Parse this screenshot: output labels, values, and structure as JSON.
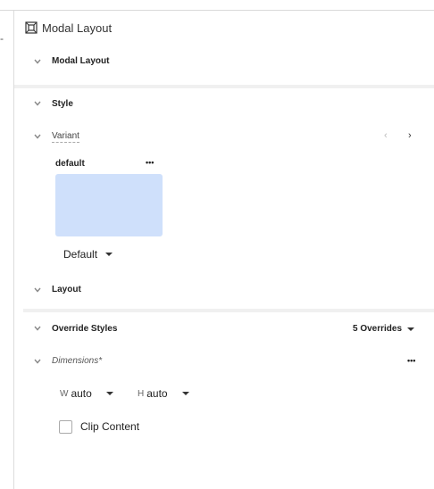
{
  "panel": {
    "title": "Modal Layout",
    "sections": {
      "modal_layout": {
        "label": "Modal Layout"
      },
      "style": {
        "label": "Style"
      },
      "variant": {
        "label": "Variant"
      },
      "layout": {
        "label": "Layout"
      },
      "override_styles": {
        "label": "Override Styles",
        "count_label": "5 Overrides"
      },
      "dimensions": {
        "label": "Dimensions*"
      }
    },
    "variant_card": {
      "name": "default",
      "menu": "•••",
      "select_value": "Default",
      "swatch_color": "#cfe0fb"
    },
    "dimensions": {
      "width_prefix": "W",
      "width_value": "auto",
      "height_prefix": "H",
      "height_value": "auto",
      "menu": "•••"
    },
    "clip_content": {
      "label": "Clip Content",
      "checked": false
    }
  }
}
